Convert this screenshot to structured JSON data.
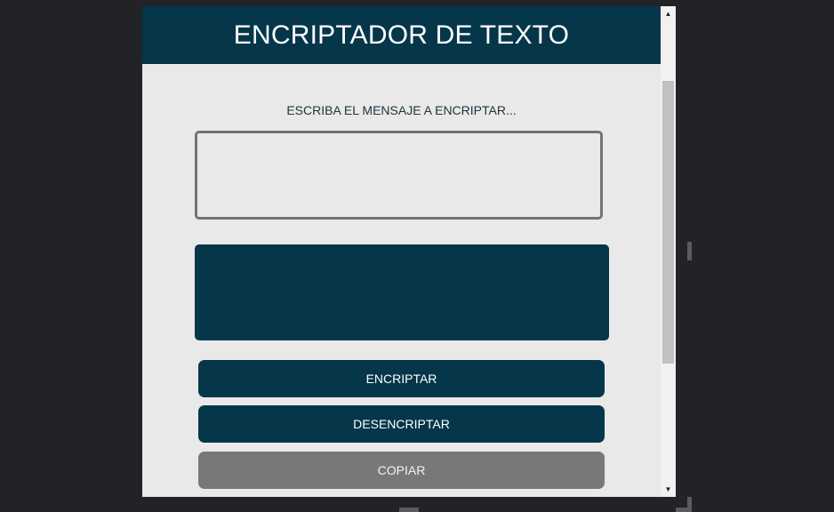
{
  "header": {
    "title": "ENCRIPTADOR DE TEXTO"
  },
  "main": {
    "prompt": "ESCRIBA EL MENSAJE A ENCRIPTAR...",
    "input_value": "",
    "output_value": "",
    "buttons": {
      "encrypt": "ENCRIPTAR",
      "decrypt": "DESENCRIPTAR",
      "copy": "COPIAR"
    }
  },
  "scrollbar": {
    "up_icon": "triangle-up",
    "down_icon": "triangle-down"
  },
  "colors": {
    "primary": "#06364a",
    "panel": "#e9e9e9",
    "copy_button": "#787878",
    "background": "#222326"
  }
}
